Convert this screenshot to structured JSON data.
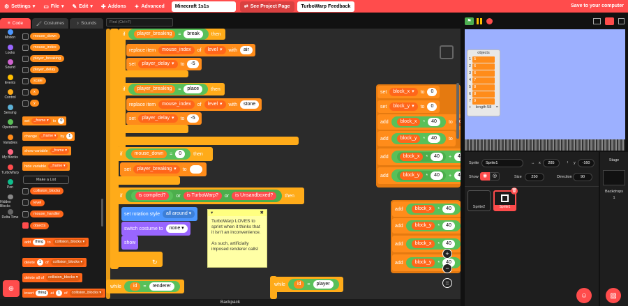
{
  "menu": {
    "settings": "Settings",
    "file": "File",
    "edit": "Edit",
    "addons": "Addons",
    "advanced": "Advanced",
    "project_title": "Minecraft 1s1s",
    "see_project_page": "See Project Page",
    "feedback": "TurboWarp Feedback",
    "save": "Save to your computer"
  },
  "tabs": {
    "code": "Code",
    "costumes": "Costumes",
    "sounds": "Sounds"
  },
  "categories": [
    {
      "label": "Motion",
      "color": "#4c97ff"
    },
    {
      "label": "Looks",
      "color": "#9966ff"
    },
    {
      "label": "Sound",
      "color": "#cf63cf"
    },
    {
      "label": "Events",
      "color": "#ffbf00"
    },
    {
      "label": "Control",
      "color": "#ffab19"
    },
    {
      "label": "Sensing",
      "color": "#5cb1d6"
    },
    {
      "label": "Operators",
      "color": "#59c059"
    },
    {
      "label": "Variables",
      "color": "#ff8c1a"
    },
    {
      "label": "My Blocks",
      "color": "#ff6680"
    },
    {
      "label": "TurboWarp",
      "color": "#ff4c4c"
    },
    {
      "label": "Pen",
      "color": "#0fbd8c"
    },
    {
      "label": "Hidden Blocks",
      "color": "#888888"
    },
    {
      "label": "Delta Time",
      "color": "#666666"
    }
  ],
  "flyout": {
    "vars": [
      "mouse_down",
      "mouse_index",
      "player_breaking",
      "player_delay",
      "scale",
      "x",
      "y"
    ],
    "set_label": "set",
    "set_var": "_frame",
    "to": "to",
    "zero": "0",
    "change": "change",
    "by": "by",
    "one": "1",
    "show_variable": "show variable",
    "hide_variable": "hide variable",
    "make_list": "Make a List",
    "lists": [
      "collision_blocks",
      "level",
      "mouse_handler",
      "objects"
    ],
    "add": "add",
    "thing": "thing",
    "delete": "delete",
    "of": "of",
    "delete_all_of": "delete all of",
    "insert": "insert",
    "at": "at",
    "list_name": "collision_blocks"
  },
  "search_placeholder": "Find (Ctrl+F)",
  "script": {
    "if": "if",
    "then": "then",
    "player_breaking": "player_breaking",
    "eq": "=",
    "break": "break",
    "replace_item": "replace item",
    "mouse_index": "mouse_index",
    "of": "of",
    "level": "level",
    "with": "with",
    "air": "air",
    "set": "set",
    "player_delay": "player_delay",
    "to": "to",
    "minus5": "-5",
    "place": "place",
    "stone": "stone",
    "mouse_down": "mouse_down",
    "zero": "0",
    "is_compiled": "is compiled?",
    "or": "or",
    "is_turbowarp": "is TurboWarp?",
    "is_unsandboxed": "is Unsandboxed?",
    "set_rotation_style": "set rotation style",
    "all_around": "all around",
    "switch_costume_to": "switch costume to",
    "none": "none",
    "show": "show",
    "while": "while",
    "id": "id",
    "renderer": "renderer",
    "player": "player",
    "block_x": "block_x",
    "block_y": "block_y",
    "add": "add",
    "forty": "40",
    "to_collis": "to",
    "collis": "collis",
    "times": "*",
    "plus": "+"
  },
  "comment": {
    "text1": "TurboWarp LOVES to sprint when it thinks that it isn't an inconvenience.",
    "text2": "As such, artificially imposed renderer calls!"
  },
  "backpack": "Backpack",
  "list_monitor": {
    "title": "objects",
    "items": [
      "5",
      "6",
      "6",
      "7",
      "8",
      "8",
      "9"
    ],
    "indices": [
      "1",
      "2",
      "3",
      "4",
      "5",
      "6",
      "7"
    ],
    "length": "length 58",
    "plus": "+",
    "eq": "="
  },
  "sprite_info": {
    "sprite_label": "Sprite",
    "sprite_name": "Sprite1",
    "x_label": "x",
    "x": "285",
    "y_label": "y",
    "y": "-160",
    "show_label": "Show",
    "size_label": "Size",
    "size": "250",
    "direction_label": "Direction",
    "direction": "90",
    "sprites": [
      "Sprite2",
      "Sprite1"
    ]
  },
  "stage_panel": {
    "title": "Stage",
    "backdrops_label": "Backdrops",
    "backdrops": "1"
  }
}
